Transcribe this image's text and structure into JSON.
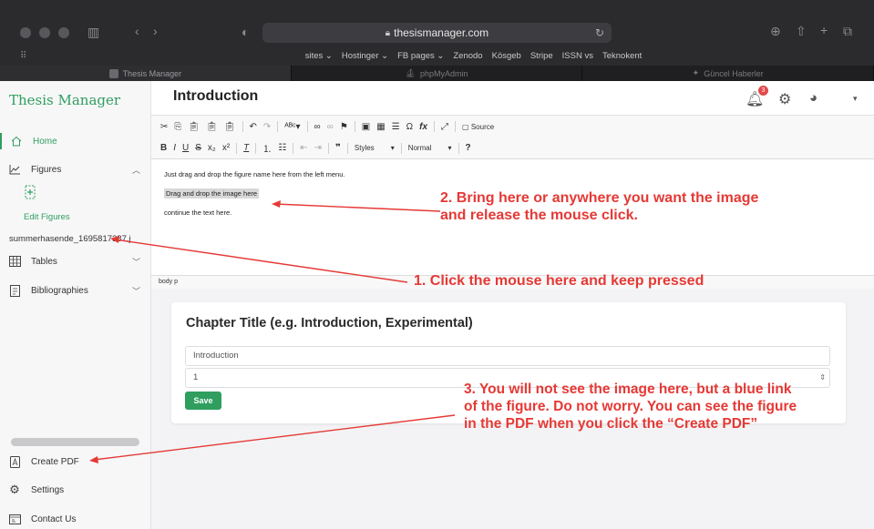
{
  "browser": {
    "url": "thesismanager.com",
    "favorites": [
      "sites ⌄",
      "Hostinger ⌄",
      "FB pages ⌄",
      "Zenodo",
      "Kösgeb",
      "Stripe",
      "ISSN vs",
      "Teknokent"
    ],
    "tabs": [
      "Thesis Manager",
      "phpMyAdmin",
      "Güncel Haberler"
    ]
  },
  "app": {
    "brand": "Thesis Manager",
    "page_title": "Introduction",
    "notification_count": "3",
    "colors": {
      "accent": "#2f9e5f",
      "annotation": "#e53935"
    }
  },
  "sidebar": {
    "home": "Home",
    "figures": "Figures",
    "edit_figures": "Edit Figures",
    "figure_file": "summerhasende_1695817387.j",
    "tables": "Tables",
    "bibliographies": "Bibliographies",
    "create_pdf": "Create PDF",
    "settings": "Settings",
    "contact": "Contact Us"
  },
  "editor": {
    "styles_label": "Styles",
    "format_label": "Normal",
    "source_label": "Source",
    "lines": [
      "Just drag and drop the figure name here from the left menu.",
      "Drag and drop the image here",
      "continue the text here."
    ],
    "path": "body  p"
  },
  "chapter_card": {
    "title": "Chapter Title (e.g. Introduction, Experimental)",
    "title_value": "Introduction",
    "order_value": "1",
    "save_label": "Save"
  },
  "annotations": {
    "step1": "1. Click the mouse here and keep pressed",
    "step2_line1": "2. Bring here or anywhere you want the image",
    "step2_line2": "and release the mouse click.",
    "step3_line1": "3. You will not see the image here, but a blue link",
    "step3_line2": "of the figure. Do not worry. You can see the figure",
    "step3_line3": "in the PDF when you click the “Create PDF”"
  }
}
